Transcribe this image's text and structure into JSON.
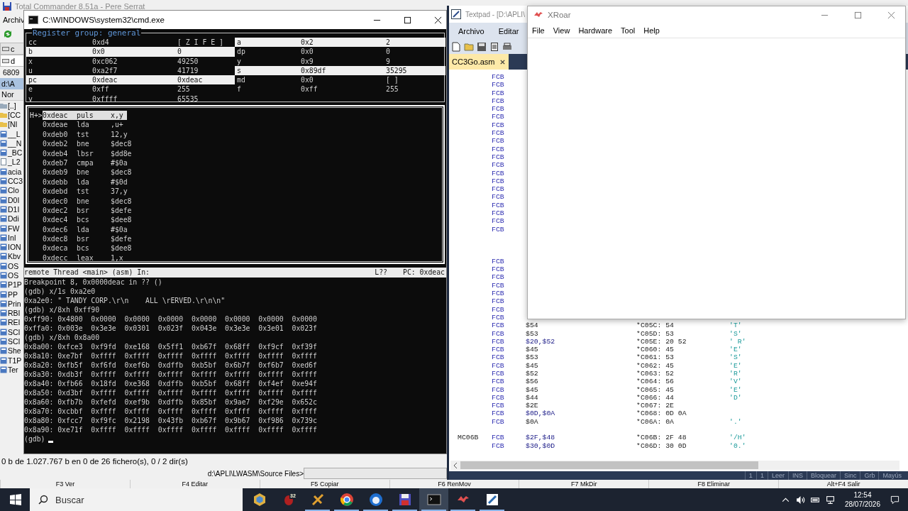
{
  "total_commander": {
    "title": "Total Commander 8.51a - Pere Serrat",
    "menu": [
      "Archiv"
    ],
    "drive_button": "c",
    "drive_combo": "d",
    "free_space": "6809",
    "path": "d:\\A",
    "column_header": "Nor",
    "items": [
      {
        "name": "[..]",
        "kind": "up"
      },
      {
        "name": "[CC",
        "kind": "folder"
      },
      {
        "name": "[NI",
        "kind": "folder"
      },
      {
        "name": "__L",
        "kind": "source"
      },
      {
        "name": "__N",
        "kind": "source"
      },
      {
        "name": "_BC",
        "kind": "source"
      },
      {
        "name": "_L2",
        "kind": "file"
      },
      {
        "name": "acia",
        "kind": "source"
      },
      {
        "name": "CC3",
        "kind": "source"
      },
      {
        "name": "Clo",
        "kind": "source"
      },
      {
        "name": "D0I",
        "kind": "source"
      },
      {
        "name": "D1I",
        "kind": "source"
      },
      {
        "name": "Ddi",
        "kind": "source"
      },
      {
        "name": "FW",
        "kind": "source"
      },
      {
        "name": "InI",
        "kind": "source"
      },
      {
        "name": "ION",
        "kind": "source"
      },
      {
        "name": "Kbv",
        "kind": "source"
      },
      {
        "name": "OS",
        "kind": "source"
      },
      {
        "name": "OS",
        "kind": "source"
      },
      {
        "name": "P1P",
        "kind": "source"
      },
      {
        "name": "PP",
        "kind": "source"
      },
      {
        "name": "Prin",
        "kind": "source"
      },
      {
        "name": "RBI",
        "kind": "source"
      },
      {
        "name": "REI",
        "kind": "source"
      },
      {
        "name": "SCI",
        "kind": "source"
      },
      {
        "name": "SCI",
        "kind": "source"
      },
      {
        "name": "She",
        "kind": "source"
      },
      {
        "name": "T1P",
        "kind": "source"
      },
      {
        "name": "Ter",
        "kind": "source"
      }
    ],
    "status": "0 b de 1.027.767 b en 0 de 26 fichero(s), 0 / 2 dir(s)",
    "command_path": "d:\\APLI\\LWASM\\Source Files>",
    "function_keys": [
      "F3 Ver",
      "F4 Editar",
      "F5 Copiar",
      "F6 RenMov",
      "F7 MkDir",
      "F8 Eliminar",
      "Alt+F4 Salir"
    ]
  },
  "cmd": {
    "title": "C:\\WINDOWS\\system32\\cmd.exe",
    "register_group": "Register group: general",
    "registers_left": [
      {
        "name": "cc",
        "hex": "0xd4",
        "value": "[ Z I F E ]",
        "changed": false
      },
      {
        "name": "b",
        "hex": "0x0",
        "value": "0",
        "changed": true
      },
      {
        "name": "x",
        "hex": "0xc062",
        "value": "49250",
        "changed": false
      },
      {
        "name": "u",
        "hex": "0xa2f7",
        "value": "41719",
        "changed": false
      },
      {
        "name": "pc",
        "hex": "0xdeac",
        "value": "0xdeac",
        "changed": true
      },
      {
        "name": "e",
        "hex": "0xff",
        "value": "255",
        "changed": false
      },
      {
        "name": "v",
        "hex": "0xffff",
        "value": "65535",
        "changed": false
      }
    ],
    "registers_right": [
      {
        "name": "a",
        "hex": "0x2",
        "value": "2",
        "changed": true
      },
      {
        "name": "dp",
        "hex": "0x0",
        "value": "0",
        "changed": false
      },
      {
        "name": "y",
        "hex": "0x9",
        "value": "9",
        "changed": false
      },
      {
        "name": "s",
        "hex": "0x89df",
        "value": "35295",
        "changed": true
      },
      {
        "name": "md",
        "hex": "0x0",
        "value": "[ ]",
        "changed": false
      },
      {
        "name": "f",
        "hex": "0xff",
        "value": "255",
        "changed": false
      }
    ],
    "disassembly": [
      {
        "marker": "H+>",
        "address": "0xdeac",
        "mnemonic": "puls",
        "operand": "x,y",
        "current": true
      },
      {
        "address": "0xdeae",
        "mnemonic": "lda",
        "operand": ",u+",
        "current": false
      },
      {
        "address": "0xdeb0",
        "mnemonic": "tst",
        "operand": "12,y",
        "current": false
      },
      {
        "address": "0xdeb2",
        "mnemonic": "bne",
        "operand": "$dec8",
        "current": false
      },
      {
        "address": "0xdeb4",
        "mnemonic": "lbsr",
        "operand": "$dd8e",
        "current": false
      },
      {
        "address": "0xdeb7",
        "mnemonic": "cmpa",
        "operand": "#$0a",
        "current": false
      },
      {
        "address": "0xdeb9",
        "mnemonic": "bne",
        "operand": "$dec8",
        "current": false
      },
      {
        "address": "0xdebb",
        "mnemonic": "lda",
        "operand": "#$0d",
        "current": false
      },
      {
        "address": "0xdebd",
        "mnemonic": "tst",
        "operand": "37,y",
        "current": false
      },
      {
        "address": "0xdec0",
        "mnemonic": "bne",
        "operand": "$dec8",
        "current": false
      },
      {
        "address": "0xdec2",
        "mnemonic": "bsr",
        "operand": "$defe",
        "current": false
      },
      {
        "address": "0xdec4",
        "mnemonic": "bcs",
        "operand": "$dee8",
        "current": false
      },
      {
        "address": "0xdec6",
        "mnemonic": "lda",
        "operand": "#$0a",
        "current": false
      },
      {
        "address": "0xdec8",
        "mnemonic": "bsr",
        "operand": "$defe",
        "current": false
      },
      {
        "address": "0xdeca",
        "mnemonic": "bcs",
        "operand": "$dee8",
        "current": false
      },
      {
        "address": "0xdecc",
        "mnemonic": "leax",
        "operand": "1,x",
        "current": false
      }
    ],
    "status": {
      "thread": "remote Thread <main> (asm) In:",
      "line": "L??",
      "pc": "PC: 0xdeac"
    },
    "console": [
      "Breakpoint 8, 0x0000deac in ?? ()",
      "(gdb) x/1s 0xa2e0",
      "0xa2e0: \" TANDY CORP.\\r\\n    ALL \\rERVED.\\r\\n\\n\"",
      "(gdb) x/8xh 0xff90",
      "0xff90: 0x4800  0x0000  0x0000  0x0000  0x0000  0x0000  0x0000  0x0000",
      "0xffa0: 0x003e  0x3e3e  0x0301  0x023f  0x043e  0x3e3e  0x3e01  0x023f",
      "(gdb) x/8xh 0x8a00",
      "0x8a00: 0xfce3  0xf9fd  0xe168  0x5ff1  0xb67f  0x68ff  0xf9cf  0xf39f",
      "0x8a10: 0xe7bf  0xffff  0xffff  0xffff  0xffff  0xffff  0xffff  0xffff",
      "0x8a20: 0xfb5f  0xf6fd  0xef6b  0xdffb  0xb5bf  0x6b7f  0xf6b7  0xed6f",
      "0x8a30: 0xdb3f  0xffff  0xffff  0xffff  0xffff  0xffff  0xffff  0xffff",
      "0x8a40: 0xfb66  0x18fd  0xe368  0xdffb  0xb5bf  0x68ff  0xf4ef  0xe94f",
      "0x8a50: 0xd3bf  0xffff  0xffff  0xffff  0xffff  0xffff  0xffff  0xffff",
      "0x8a60: 0xfb7b  0xfefd  0xef9b  0xdffb  0x85bf  0x9ae7  0xf29e  0x652c",
      "0x8a70: 0xcbbf  0xffff  0xffff  0xffff  0xffff  0xffff  0xffff  0xffff",
      "0x8a80: 0xfcc7  0xf9fc  0x2198  0x43fb  0xb67f  0x9b67  0xf986  0x739c",
      "0x8a90: 0xe71f  0xffff  0xffff  0xffff  0xffff  0xffff  0xffff  0xffff"
    ],
    "prompt": "(gdb)"
  },
  "textpad": {
    "title": "Textpad - [D:\\APLI\\",
    "menu": [
      "Archivo",
      "Editar"
    ],
    "tab": {
      "label": "CC3Go.asm",
      "selected": true
    },
    "lines": [
      {
        "kind": "covered",
        "mnemonic": "FCB"
      },
      {
        "kind": "covered",
        "mnemonic": "FCB"
      },
      {
        "kind": "covered",
        "mnemonic": "FCB"
      },
      {
        "kind": "covered",
        "mnemonic": "FCB"
      },
      {
        "kind": "covered",
        "mnemonic": "FCB"
      },
      {
        "kind": "covered",
        "mnemonic": "FCB"
      },
      {
        "kind": "covered",
        "mnemonic": "FCB"
      },
      {
        "kind": "covered",
        "mnemonic": "FCB"
      },
      {
        "kind": "covered",
        "mnemonic": "FCB"
      },
      {
        "kind": "covered",
        "mnemonic": "FCB"
      },
      {
        "kind": "covered",
        "mnemonic": "FCB"
      },
      {
        "kind": "covered",
        "mnemonic": "FCB"
      },
      {
        "kind": "covered",
        "mnemonic": "FCB"
      },
      {
        "kind": "covered",
        "mnemonic": "FCB"
      },
      {
        "kind": "covered",
        "mnemonic": "FCB"
      },
      {
        "kind": "covered",
        "mnemonic": "FCB"
      },
      {
        "kind": "covered",
        "mnemonic": "FCB"
      },
      {
        "kind": "covered",
        "mnemonic": "FCB"
      },
      {
        "kind": "covered",
        "mnemonic": "FCB"
      },
      {
        "kind": "covered",
        "mnemonic": "FCB"
      },
      {
        "kind": "blank"
      },
      {
        "kind": "blank"
      },
      {
        "kind": "blank"
      },
      {
        "kind": "covered",
        "mnemonic": "FCB"
      },
      {
        "kind": "covered",
        "mnemonic": "FCB"
      },
      {
        "kind": "covered",
        "mnemonic": "FCB"
      },
      {
        "kind": "covered",
        "mnemonic": "FCB"
      },
      {
        "kind": "covered",
        "mnemonic": "FCB"
      },
      {
        "kind": "covered",
        "mnemonic": "FCB"
      },
      {
        "kind": "covered",
        "mnemonic": "FCB"
      },
      {
        "kind": "covered",
        "mnemonic": "FCB"
      },
      {
        "kind": "code",
        "mnemonic": "FCB",
        "operand": "$54",
        "comment": "*C05C: 54",
        "chars": "'T'"
      },
      {
        "kind": "code",
        "mnemonic": "FCB",
        "operand": "$53",
        "comment": "*C05D: 53",
        "chars": "'S'"
      },
      {
        "kind": "code",
        "mnemonic": "FCB",
        "operand": "$20,$52",
        "comment": "*C05E: 20 52",
        "chars": "' R'"
      },
      {
        "kind": "code",
        "mnemonic": "FCB",
        "operand": "$45",
        "comment": "*C060: 45",
        "chars": "'E'"
      },
      {
        "kind": "code",
        "mnemonic": "FCB",
        "operand": "$53",
        "comment": "*C061: 53",
        "chars": "'S'"
      },
      {
        "kind": "code",
        "mnemonic": "FCB",
        "operand": "$45",
        "comment": "*C062: 45",
        "chars": "'E'"
      },
      {
        "kind": "code",
        "mnemonic": "FCB",
        "operand": "$52",
        "comment": "*C063: 52",
        "chars": "'R'"
      },
      {
        "kind": "code",
        "mnemonic": "FCB",
        "operand": "$56",
        "comment": "*C064: 56",
        "chars": "'V'"
      },
      {
        "kind": "code",
        "mnemonic": "FCB",
        "operand": "$45",
        "comment": "*C065: 45",
        "chars": "'E'"
      },
      {
        "kind": "code",
        "mnemonic": "FCB",
        "operand": "$44",
        "comment": "*C066: 44",
        "chars": "'D'"
      },
      {
        "kind": "code",
        "mnemonic": "FCB",
        "operand": "$2E",
        "comment": "*C067: 2E"
      },
      {
        "kind": "code",
        "mnemonic": "FCB",
        "operand": "$0D,$0A",
        "comment": "*C068: 0D 0A"
      },
      {
        "kind": "code",
        "mnemonic": "FCB",
        "operand": "$0A",
        "comment": "*C06A: 0A",
        "chars": "'.'"
      },
      {
        "kind": "blank"
      },
      {
        "kind": "code",
        "label": "MC06B",
        "mnemonic": "FCB",
        "operand": "$2F,$48",
        "comment": "*C06B: 2F 48",
        "chars": "'/H'"
      },
      {
        "kind": "code",
        "mnemonic": "FCB",
        "operand": "$30,$0D",
        "comment": "*C06D: 30 0D",
        "chars": "'0.'"
      }
    ],
    "status_bar": [
      "1",
      "1",
      "Leer",
      "INS",
      "Bloquear",
      "Sinc",
      "Grb",
      "Mayús"
    ]
  },
  "xroar": {
    "title": "XRoar",
    "menu": [
      "File",
      "View",
      "Hardware",
      "Tool",
      "Help"
    ]
  },
  "taskbar": {
    "search_placeholder": "Buscar",
    "apps": [
      {
        "kind": "hexagon",
        "selected": false,
        "running": false
      },
      {
        "kind": "bug",
        "badge": "32",
        "selected": false,
        "running": false
      },
      {
        "kind": "tool",
        "selected": false,
        "running": true
      },
      {
        "kind": "browser",
        "selected": false,
        "running": true
      },
      {
        "kind": "mail",
        "selected": false,
        "running": true
      },
      {
        "kind": "floppy",
        "selected": false,
        "running": true
      },
      {
        "kind": "terminal",
        "selected": true,
        "running": true
      },
      {
        "kind": "bird",
        "selected": false,
        "running": true
      },
      {
        "kind": "editor",
        "selected": false,
        "running": true
      }
    ],
    "time": "12:54",
    "date": "28/07/2026"
  }
}
